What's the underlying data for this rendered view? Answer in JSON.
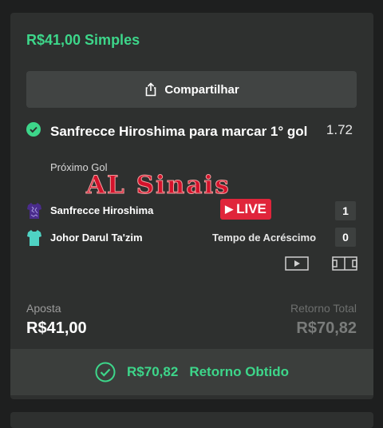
{
  "bet": {
    "title": "R$41,00 Simples",
    "share_label": "Compartilhar",
    "selection": "Sanfrecce Hiroshima para marcar 1° gol",
    "odds": "1.72",
    "market": "Próximo Gol",
    "watermark": "AL Sinais"
  },
  "match": {
    "home_team": "Sanfrecce Hiroshima",
    "away_team": "Johor Darul Ta'zim",
    "live_label": "LIVE",
    "period": "Tempo de Acréscimo",
    "home_score": "1",
    "away_score": "0"
  },
  "totals": {
    "stake_label": "Aposta",
    "stake_value": "R$41,00",
    "return_label": "Retorno Total",
    "return_value": "R$70,82"
  },
  "footer": {
    "amount": "R$70,82",
    "text": "Retorno Obtido"
  },
  "colors": {
    "accent_green": "#3dd68a",
    "live_red": "#e0253b",
    "card_bg": "#2e302f",
    "page_bg": "#1e1f1f"
  },
  "icons": {
    "share": "share-icon",
    "check": "check-circle-icon",
    "video": "video-play-icon",
    "field": "pitch-icon",
    "home_kit": "purple-shirt-icon",
    "away_kit": "teal-shirt-icon"
  }
}
